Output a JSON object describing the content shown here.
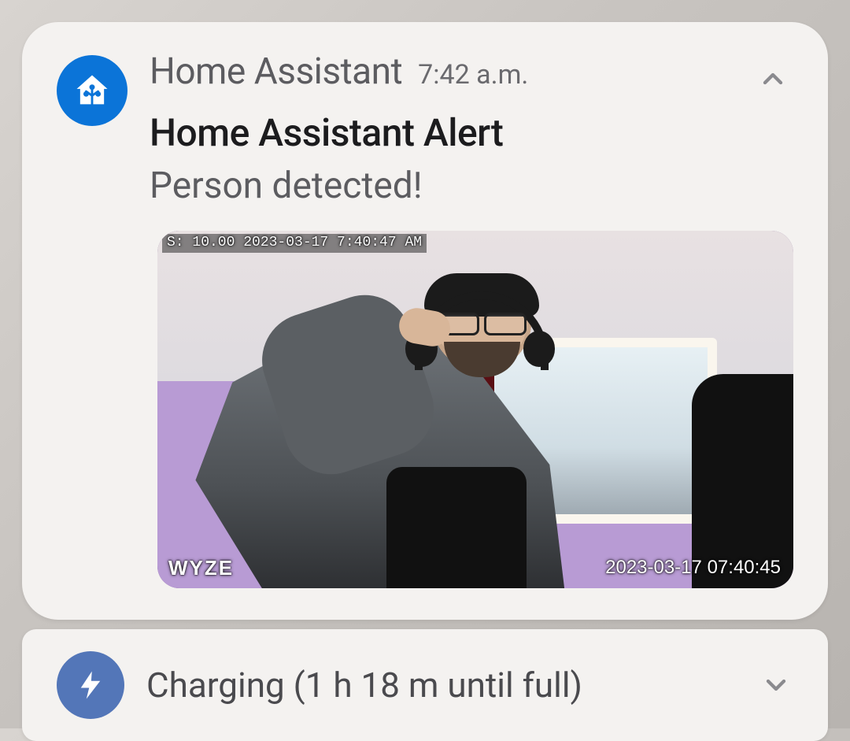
{
  "notification": {
    "app_name": "Home Assistant",
    "time": "7:42 a.m.",
    "title": "Home Assistant Alert",
    "body": "Person detected!",
    "icon_name": "home-assistant-icon",
    "icon_bg": "#0b74d8",
    "camera": {
      "osd_top": "S: 10.00 2023-03-17 7:40:47 AM",
      "watermark": "WYZE",
      "timestamp": "2023-03-17 07:40:45"
    }
  },
  "system_notification": {
    "text": "Charging (1 h 18 m until full)",
    "icon_name": "lightning-bolt-icon",
    "icon_bg": "#5376b8"
  }
}
